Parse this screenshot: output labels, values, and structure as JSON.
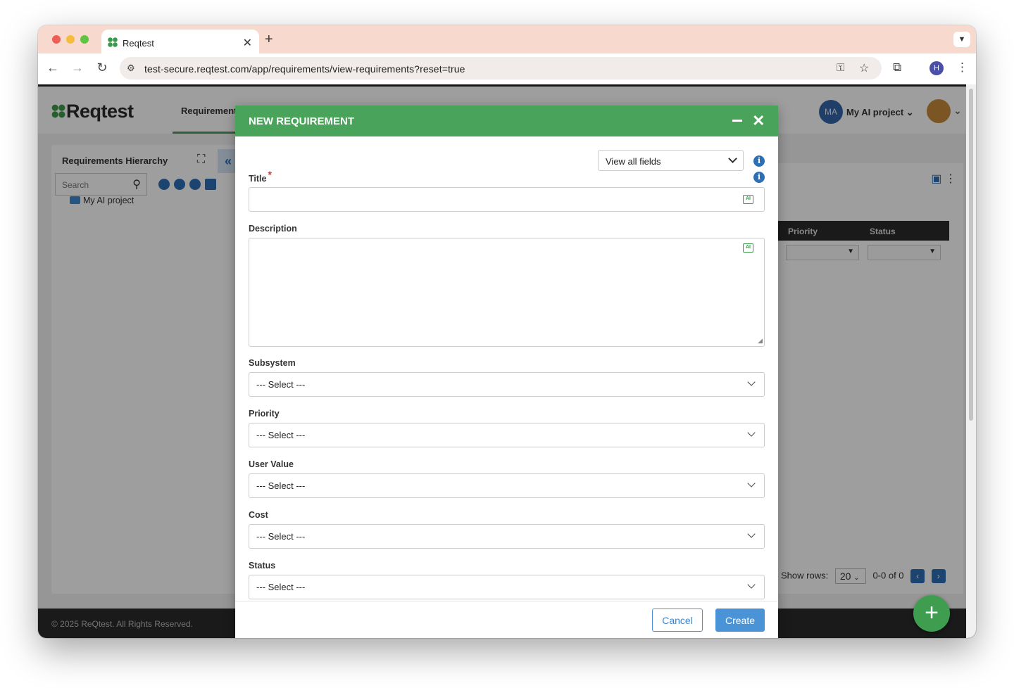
{
  "browser": {
    "tab_title": "Reqtest",
    "url": "test-secure.reqtest.com/app/requirements/view-requirements?reset=true",
    "profile_initial": "H"
  },
  "app": {
    "logo": "Reqtest",
    "nav_tab": "Requirements",
    "project_initials": "MA",
    "project_name": "My AI project"
  },
  "left_panel": {
    "title": "Requirements Hierarchy",
    "search_placeholder": "Search",
    "tree_root": "My AI project"
  },
  "grid": {
    "columns": [
      "Priority",
      "Status"
    ],
    "pager": {
      "label": "Show rows:",
      "rows": "20",
      "range": "0-0 of 0"
    }
  },
  "footer": {
    "copyright": "© 2025 ReQtest. All Rights Reserved."
  },
  "modal": {
    "title": "NEW REQUIREMENT",
    "view_selector": "View all fields",
    "fields": {
      "title": {
        "label": "Title",
        "value": ""
      },
      "description": {
        "label": "Description",
        "value": ""
      },
      "subsystem": {
        "label": "Subsystem",
        "value": "--- Select ---"
      },
      "priority": {
        "label": "Priority",
        "value": "--- Select ---"
      },
      "user_value": {
        "label": "User Value",
        "value": "--- Select ---"
      },
      "cost": {
        "label": "Cost",
        "value": "--- Select ---"
      },
      "status": {
        "label": "Status",
        "value": "--- Select ---"
      }
    },
    "buttons": {
      "cancel": "Cancel",
      "create": "Create"
    }
  },
  "colors": {
    "modal_header": "#4aa35a",
    "primary_button": "#4a93d6",
    "info_icon": "#2d6fb5",
    "tab_bar": "#f8d9cd"
  }
}
